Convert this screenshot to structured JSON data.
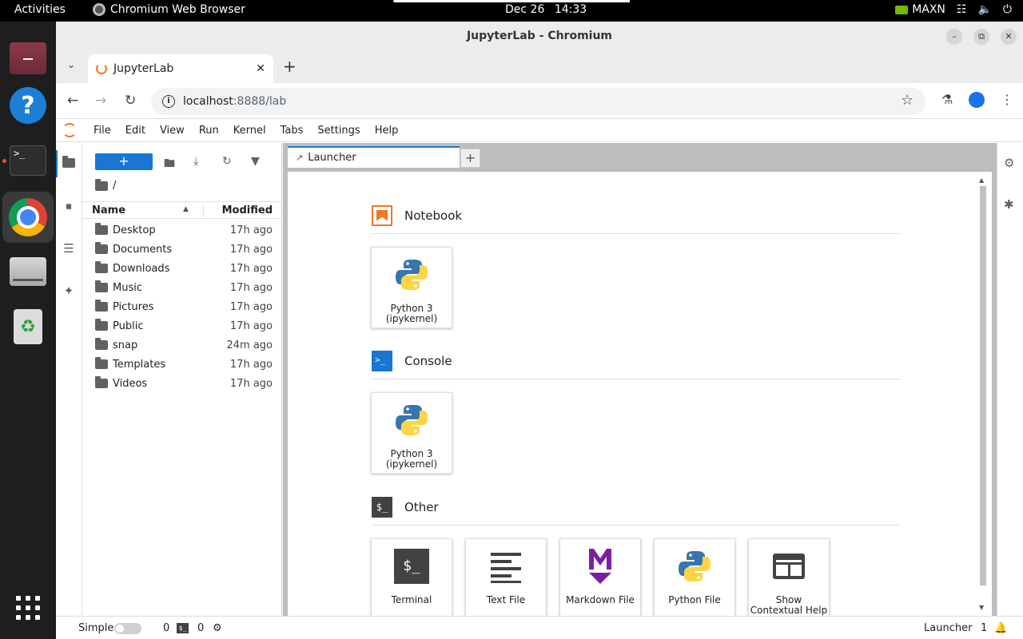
{
  "topbar": {
    "activities": "Activities",
    "app_name": "Chromium Web Browser",
    "date": "Dec 26",
    "time": "14:33",
    "power_mode": "MAXN"
  },
  "window": {
    "title": "JupyterLab - Chromium",
    "tab_title": "JupyterLab",
    "url_host": "localhost",
    "url_path": ":8888/lab"
  },
  "jupyter": {
    "menu": [
      "File",
      "Edit",
      "View",
      "Run",
      "Kernel",
      "Tabs",
      "Settings",
      "Help"
    ],
    "filebrowser": {
      "new_label": "+",
      "breadcrumb": "/",
      "col_name": "Name",
      "col_modified": "Modified",
      "files": [
        {
          "name": "Desktop",
          "modified": "17h ago"
        },
        {
          "name": "Documents",
          "modified": "17h ago"
        },
        {
          "name": "Downloads",
          "modified": "17h ago"
        },
        {
          "name": "Music",
          "modified": "17h ago"
        },
        {
          "name": "Pictures",
          "modified": "17h ago"
        },
        {
          "name": "Public",
          "modified": "17h ago"
        },
        {
          "name": "snap",
          "modified": "24m ago"
        },
        {
          "name": "Templates",
          "modified": "17h ago"
        },
        {
          "name": "Videos",
          "modified": "17h ago"
        }
      ]
    },
    "main_tab": "Launcher",
    "launcher": {
      "notebook": {
        "title": "Notebook",
        "cards": [
          {
            "line1": "Python 3",
            "line2": "(ipykernel)"
          }
        ]
      },
      "console": {
        "title": "Console",
        "cards": [
          {
            "line1": "Python 3",
            "line2": "(ipykernel)"
          }
        ]
      },
      "other": {
        "title": "Other",
        "cards": [
          {
            "line1": "Terminal",
            "line2": ""
          },
          {
            "line1": "Text File",
            "line2": ""
          },
          {
            "line1": "Markdown File",
            "line2": ""
          },
          {
            "line1": "Python File",
            "line2": ""
          },
          {
            "line1": "Show",
            "line2": "Contextual Help"
          }
        ]
      }
    },
    "status": {
      "simple_label": "Simple",
      "kernels_count": "0",
      "terminals_count": "0",
      "mode": "Launcher",
      "notifications": "1"
    }
  }
}
